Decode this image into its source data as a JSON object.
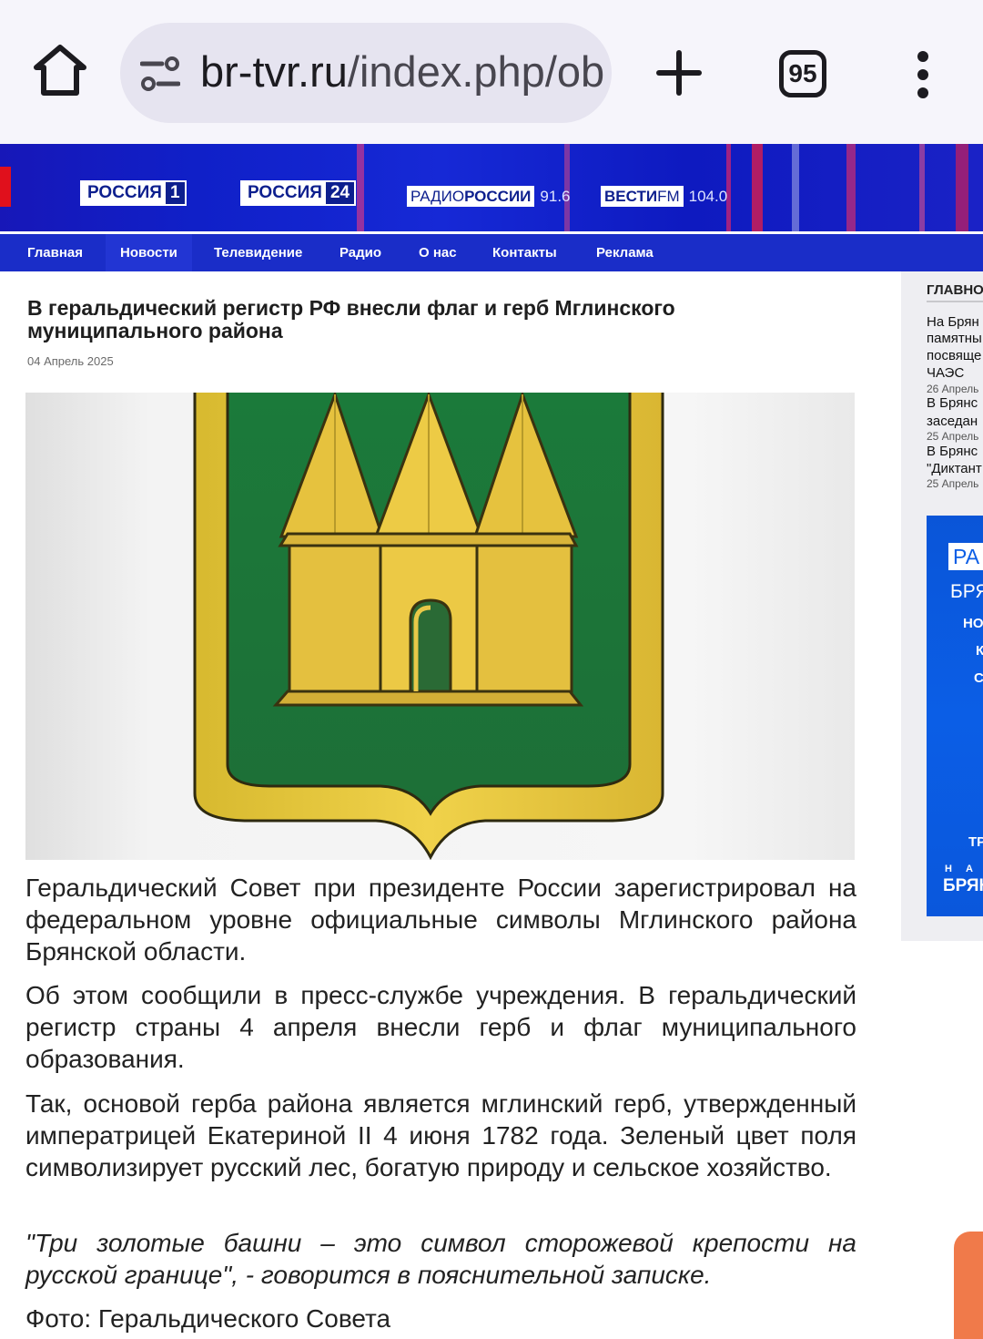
{
  "browser": {
    "url_host": "br-tvr.ru",
    "url_path": "/index.php/ob",
    "tab_count": "95",
    "icons": [
      "home-icon",
      "site-settings-icon",
      "new-tab-icon",
      "tab-switcher-icon",
      "more-menu-icon"
    ]
  },
  "header": {
    "logos": {
      "russia1_text": "РОССИЯ",
      "russia1_num": "1",
      "russia24_text": "РОССИЯ",
      "russia24_num": "24",
      "radio_a": "РАДИО",
      "radio_b": "РОССИИ",
      "radio_freq": "91.6",
      "vesti_a": "ВЕСТИ",
      "vesti_b": "FM",
      "vesti_freq": "104.0"
    },
    "nav": [
      "Главная",
      "Новости",
      "Телевидение",
      "Радио",
      "О нас",
      "Контакты",
      "Реклама"
    ],
    "colors": {
      "header_blue": "#1a2dc8",
      "accent_red": "#e0101c"
    }
  },
  "article": {
    "title": "В геральдический регистр РФ внесли флаг и герб Мглинского муниципального района",
    "date": "04 Апрель 2025",
    "paragraphs": [
      "Геральдический Совет при президенте России зарегистрировал на федеральном уровне официальные символы Мглинского района Брянской области.",
      "Об этом сообщили в пресс-службе учреждения. В геральдический регистр страны 4 апреля внесли герб и флаг муниципального образования.",
      "Так, основой герба района является мглинский герб, утвержденный императрицей Екатериной II 4 июня 1782 года. Зеленый цвет поля символизирует русский лес, богатую природу и сельское хозяйство.",
      "\"Три золотые башни – это символ сторожевой крепости на русской границе\", - говорится в пояснительной записке.",
      "Фото: Геральдического Совета"
    ]
  },
  "sidebar": {
    "heading": "ГЛАВНО",
    "news": [
      {
        "lines": [
          "На Брян",
          "памятны",
          "посвяще",
          "ЧАЭС"
        ],
        "date": "26 Апрель"
      },
      {
        "lines": [
          "В Брянс",
          "заседан"
        ],
        "date": "25 Апрель"
      },
      {
        "lines": [
          "В Брянс",
          "\"Диктант"
        ],
        "date": "25 Апрель"
      }
    ],
    "banner": {
      "ra": "РА",
      "bry": "БРЯ",
      "items": [
        "НО",
        "К",
        "С"
      ],
      "tr": "ТР",
      "na": "Н А",
      "bryan": "БРЯН"
    }
  }
}
